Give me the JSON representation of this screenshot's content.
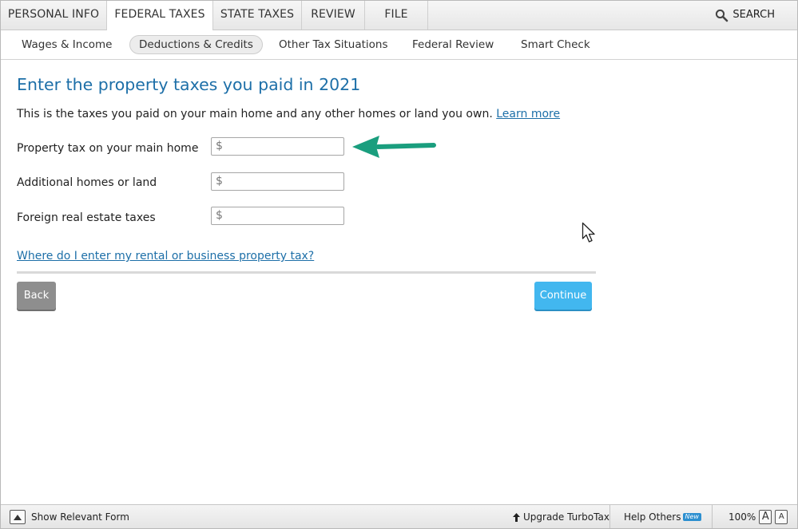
{
  "topnav": {
    "tabs": [
      {
        "label": "PERSONAL INFO"
      },
      {
        "label": "FEDERAL TAXES"
      },
      {
        "label": "STATE TAXES"
      },
      {
        "label": "REVIEW"
      },
      {
        "label": "FILE"
      }
    ],
    "active_tab": "FEDERAL TAXES",
    "search_label": "SEARCH",
    "search_icon": "magnifier-icon"
  },
  "subnav": {
    "items": [
      {
        "label": "Wages & Income"
      },
      {
        "label": "Deductions & Credits"
      },
      {
        "label": "Other Tax Situations"
      },
      {
        "label": "Federal Review"
      },
      {
        "label": "Smart Check"
      }
    ],
    "active_item": "Deductions & Credits"
  },
  "main": {
    "title": "Enter the property taxes you paid in 2021",
    "description": "This is the taxes you paid on your main home and any other homes or land you own.",
    "learn_more": "Learn more",
    "fields": [
      {
        "label": "Property tax on your main home",
        "currency": "$",
        "value": ""
      },
      {
        "label": "Additional homes or land",
        "currency": "$",
        "value": ""
      },
      {
        "label": "Foreign real estate taxes",
        "currency": "$",
        "value": ""
      }
    ],
    "rental_link": "Where do I enter my rental or business property tax?",
    "back_label": "Back",
    "continue_label": "Continue",
    "arrow_color": "#1a9e7e",
    "accent_color": "#1d6fa8",
    "continue_color": "#42b7ef"
  },
  "bottombar": {
    "show_form": "Show Relevant Form",
    "upgrade": "Upgrade TurboTax",
    "help_others": "Help Others",
    "new_badge": "New",
    "zoom": "100%",
    "font_large": "A",
    "font_small": "A"
  }
}
